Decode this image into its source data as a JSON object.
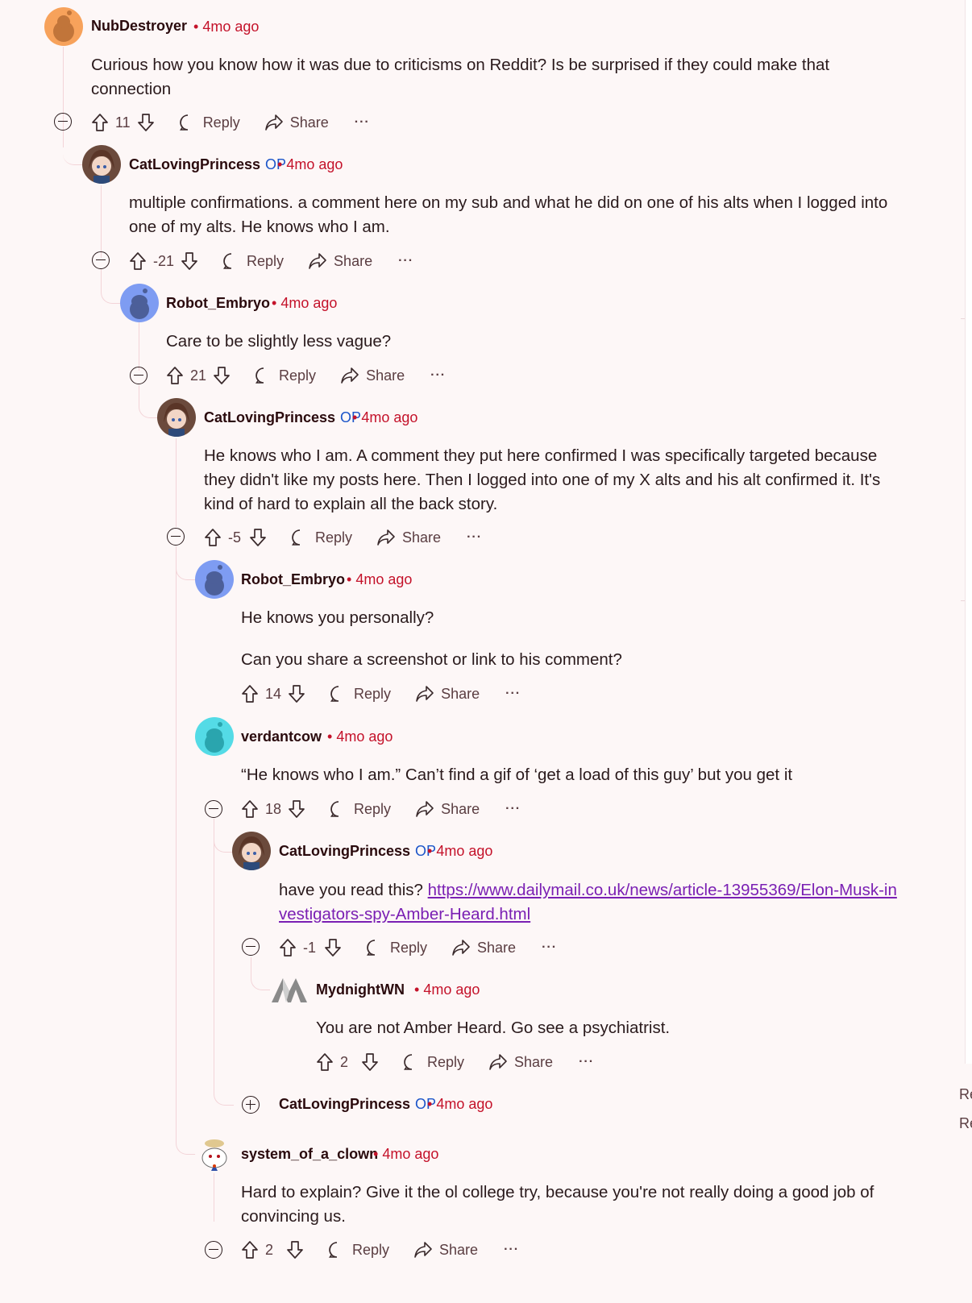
{
  "comments": [
    {
      "user": "NubDestroyer",
      "op": false,
      "time": "4mo ago",
      "body": [
        "Curious how you know how it was due to criticisms on Reddit? Is be surprised if they could make that connection"
      ],
      "score": "11"
    },
    {
      "user": "CatLovingPrincess",
      "op": true,
      "time": "4mo ago",
      "body": [
        "multiple confirmations. a comment here on my sub and what he did on one of his alts when I logged into one of my alts. He knows who I am."
      ],
      "score": "-21"
    },
    {
      "user": "Robot_Embryo",
      "op": false,
      "time": "4mo ago",
      "body": [
        "Care to be slightly less vague?"
      ],
      "score": "21"
    },
    {
      "user": "CatLovingPrincess",
      "op": true,
      "time": "4mo ago",
      "body": [
        "He knows who I am. A comment they put here confirmed I was specifically targeted because they didn't like my posts here. Then I logged into one of my X alts and his alt confirmed it. It's kind of hard to explain all the back story."
      ],
      "score": "-5"
    },
    {
      "user": "Robot_Embryo",
      "op": false,
      "time": "4mo ago",
      "body": [
        "He knows you personally?",
        "Can you share a screenshot or link to his comment?"
      ],
      "score": "14"
    },
    {
      "user": "verdantcow",
      "op": false,
      "time": "4mo ago",
      "body": [
        "“He knows who I am.” Can’t find a gif of ‘get a load of this guy’ but you get it"
      ],
      "score": "18"
    },
    {
      "user": "CatLovingPrincess",
      "op": true,
      "time": "4mo ago",
      "body_prefix": "have you read this? ",
      "link": "https://www.dailymail.co.uk/news/article-13955369/Elon-Musk-investigators-spy-Amber-Heard.html",
      "score": "-1"
    },
    {
      "user": "MydnightWN",
      "op": false,
      "time": "4mo ago",
      "body": [
        "You are not Amber Heard. Go see a psychiatrist."
      ],
      "score": "2"
    },
    {
      "user": "CatLovingPrincess",
      "op": true,
      "time": "4mo ago",
      "collapsed": true
    },
    {
      "user": "system_of_a_clown",
      "op": false,
      "time": "4mo ago",
      "body": [
        "Hard to explain? Give it the ol college try, because you're not really doing a good job of convincing us."
      ],
      "score": "2"
    }
  ],
  "labels": {
    "op": "OP",
    "dot": "•",
    "reply": "Reply",
    "share": "Share",
    "more": "···"
  },
  "sidebar_edge": [
    "Re",
    "Re"
  ],
  "colors": {
    "background": "#fdf7f7",
    "username": "#2a0a0d",
    "timestamp": "#c4122a",
    "op_badge": "#1c55c9",
    "link": "#7a1fb3",
    "thread_line": "#f3d4d8"
  },
  "icons": [
    "upvote-icon",
    "downvote-icon",
    "reply-bubble-icon",
    "share-arrow-icon",
    "more-dots-icon",
    "collapse-minus-icon",
    "expand-plus-icon"
  ]
}
